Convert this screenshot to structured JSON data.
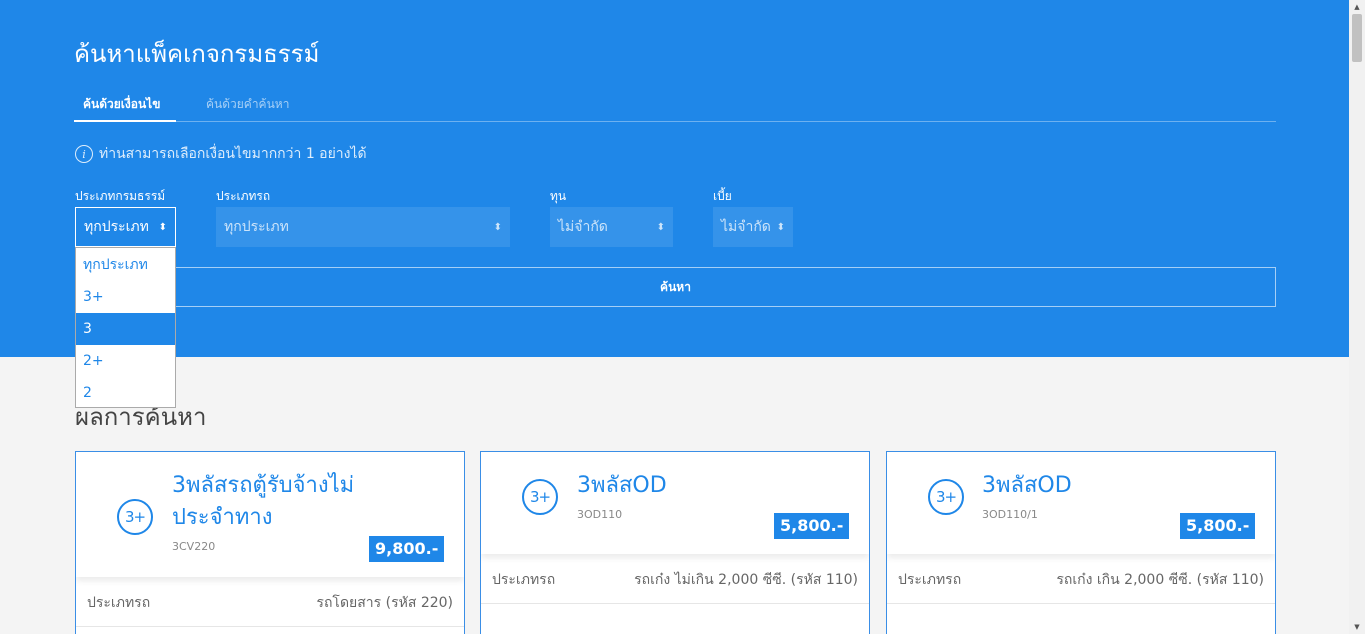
{
  "hero": {
    "title": "ค้นหาแพ็คเกจกรมธรรม์",
    "tabs": [
      {
        "label": "ค้นด้วยเงื่อนไข",
        "active": true
      },
      {
        "label": "ค้นด้วยคำค้นหา",
        "active": false
      }
    ],
    "info_icon_text": "i",
    "info_text": "ท่านสามารถเลือกเงื่อนไขมากกว่า 1 อย่างได้"
  },
  "filters": {
    "policy_type": {
      "label": "ประเภทกรมธรรม์",
      "value": "ทุกประเภท",
      "arrows": "⬍"
    },
    "car_type": {
      "label": "ประเภทรถ",
      "value": "ทุกประเภท",
      "arrows": "⬍"
    },
    "sum_insured": {
      "label": "ทุน",
      "value": "ไม่จำกัด",
      "arrows": "⬍"
    },
    "premium": {
      "label": "เบี้ย",
      "value": "ไม่จำกัด",
      "arrows": "⬍"
    }
  },
  "dropdown": {
    "options": [
      "ทุกประเภท",
      "3+",
      "3",
      "2+",
      "2"
    ],
    "highlighted": "3"
  },
  "search_button": "ค้นหา",
  "results": {
    "title": "ผลการค้นหา",
    "cards": [
      {
        "badge": "3+",
        "title": "3พลัสรถตู้รับจ้างไม่ประจำทาง",
        "code": "3CV220",
        "price": "9,800.-",
        "rows": [
          {
            "label": "ประเภทรถ",
            "value": "รถโดยสาร (รหัส 220)"
          }
        ]
      },
      {
        "badge": "3+",
        "title": "3พลัสOD",
        "code": "3OD110",
        "price": "5,800.-",
        "rows": [
          {
            "label": "ประเภทรถ",
            "value": "รถเก๋ง ไม่เกิน 2,000 ซีซี. (รหัส 110)"
          }
        ]
      },
      {
        "badge": "3+",
        "title": "3พลัสOD",
        "code": "3OD110/1",
        "price": "5,800.-",
        "rows": [
          {
            "label": "ประเภทรถ",
            "value": "รถเก๋ง เกิน 2,000 ซีซี. (รหัส 110)"
          }
        ]
      }
    ]
  },
  "scrollbar": {
    "up": "▲",
    "down": "▼"
  },
  "colors": {
    "primary": "#1f87e8",
    "background": "#f4f4f4"
  }
}
